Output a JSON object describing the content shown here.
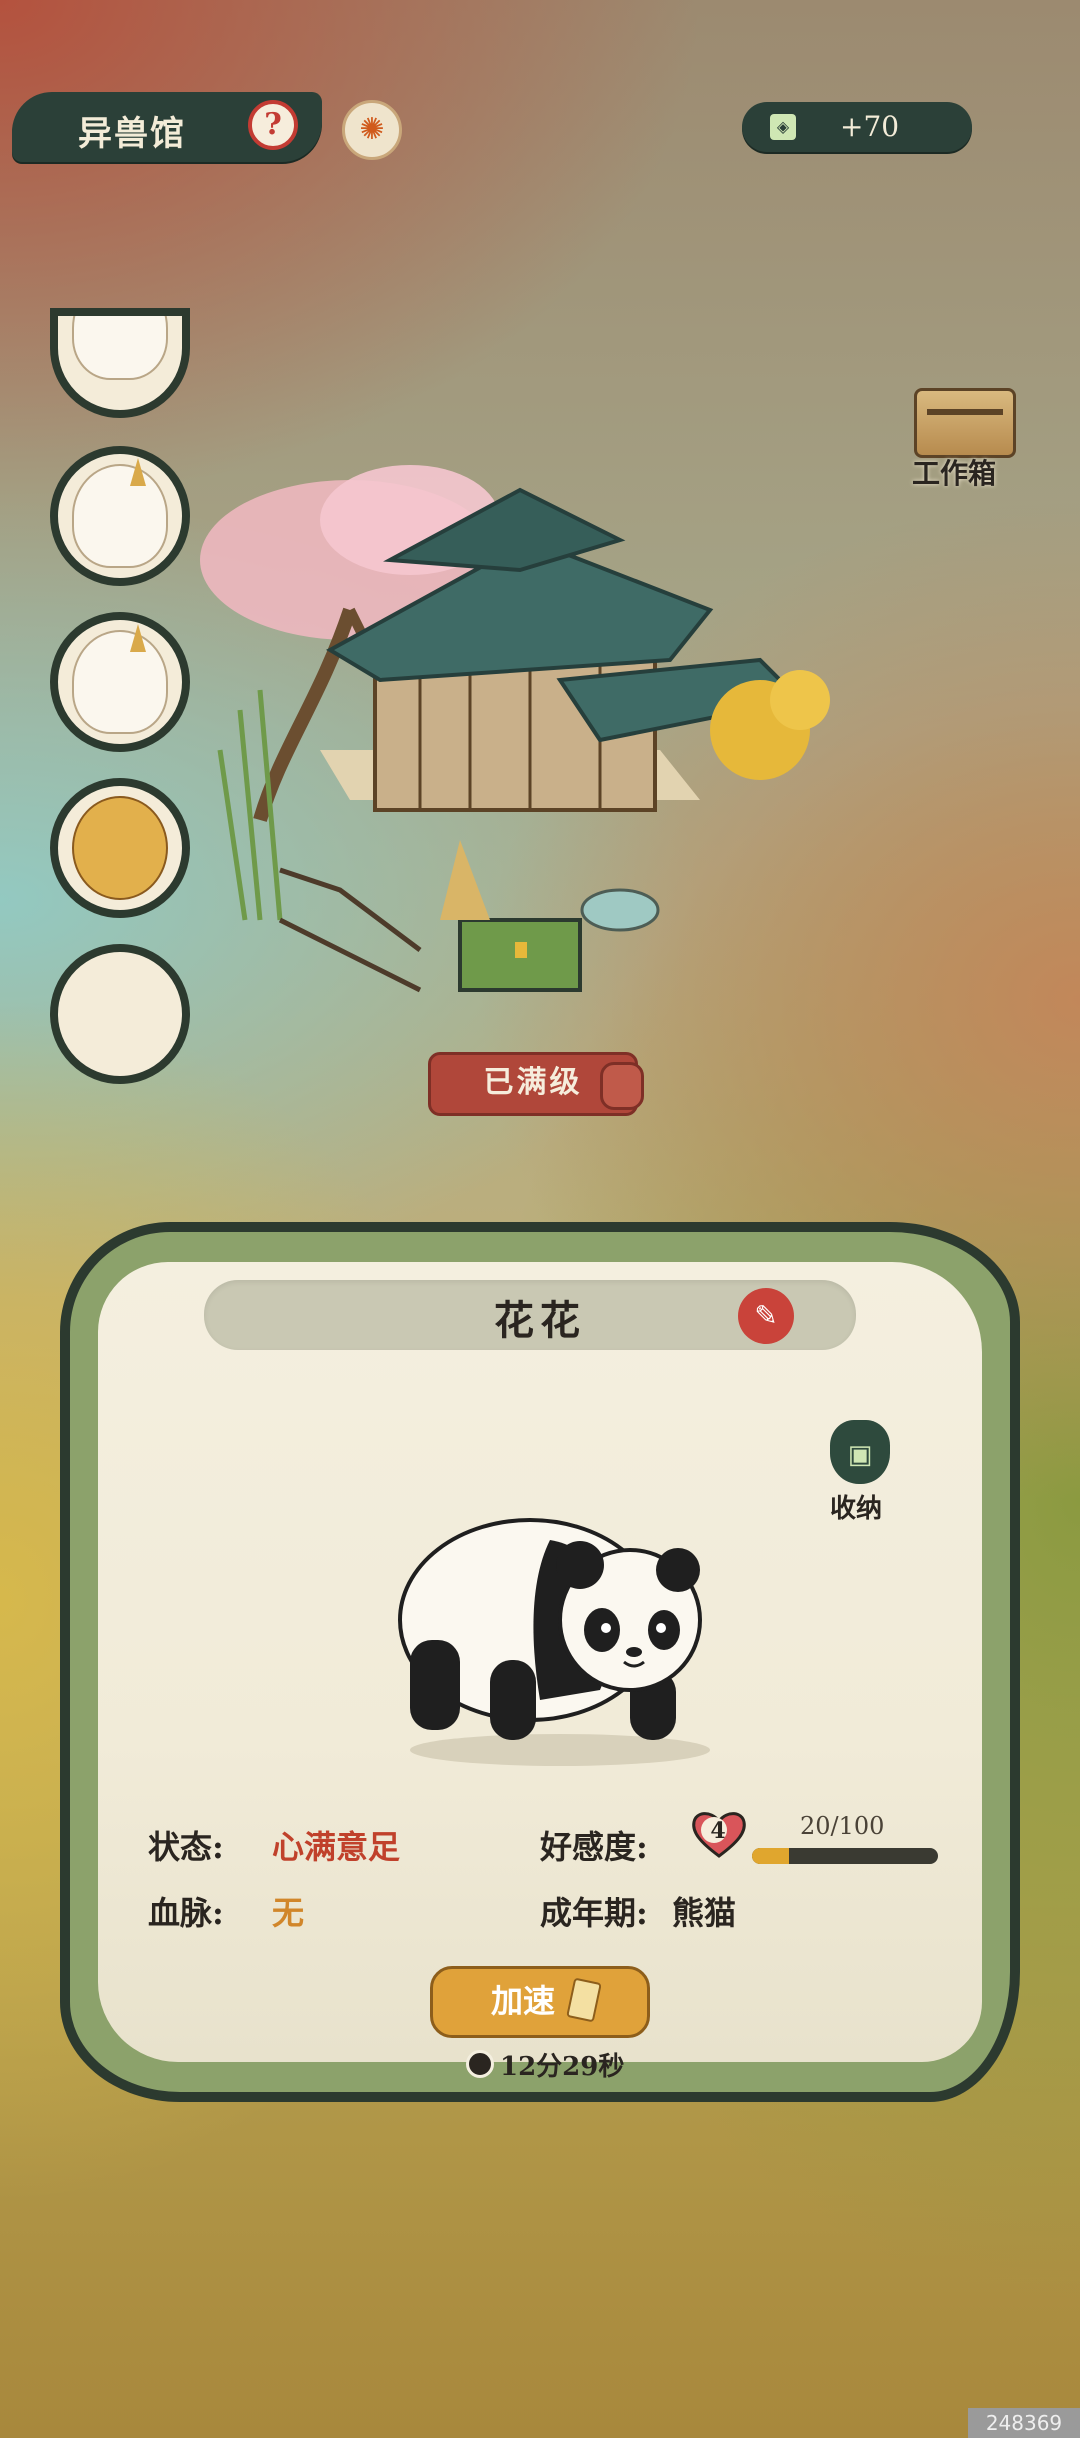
{
  "header": {
    "title": "异兽馆",
    "help_icon": "question-mark-icon",
    "guardian_icon": "phoenix-icon",
    "currency_icon": "jade-token-icon",
    "currency_value": "+70"
  },
  "workbox": {
    "label": "工作箱",
    "icon": "treasure-chest-icon"
  },
  "beast_slots": [
    {
      "icon": "fox-beast-avatar"
    },
    {
      "icon": "unicorn-horse-avatar"
    },
    {
      "icon": "unicorn-horse-avatar"
    },
    {
      "icon": "monkey-king-avatar"
    },
    {
      "icon": "empty-slot"
    }
  ],
  "building": {
    "badge": "已满级"
  },
  "panel": {
    "name": "花花",
    "storage_label": "收纳",
    "status_label": "状态:",
    "status_value": "心满意足",
    "bloodline_label": "血脉:",
    "bloodline_value": "无",
    "affection_label": "好感度:",
    "affection_level": "4",
    "affection_text": "20/100",
    "affection_progress": 0.2,
    "adult_label": "成年期:",
    "adult_value": "熊猫",
    "speedup_label": "加速",
    "timer": "12分29秒"
  },
  "watermark": "248369",
  "colors": {
    "accent_red": "#c0412b",
    "accent_orange": "#e0a23a",
    "dark_green": "#2b4038"
  }
}
